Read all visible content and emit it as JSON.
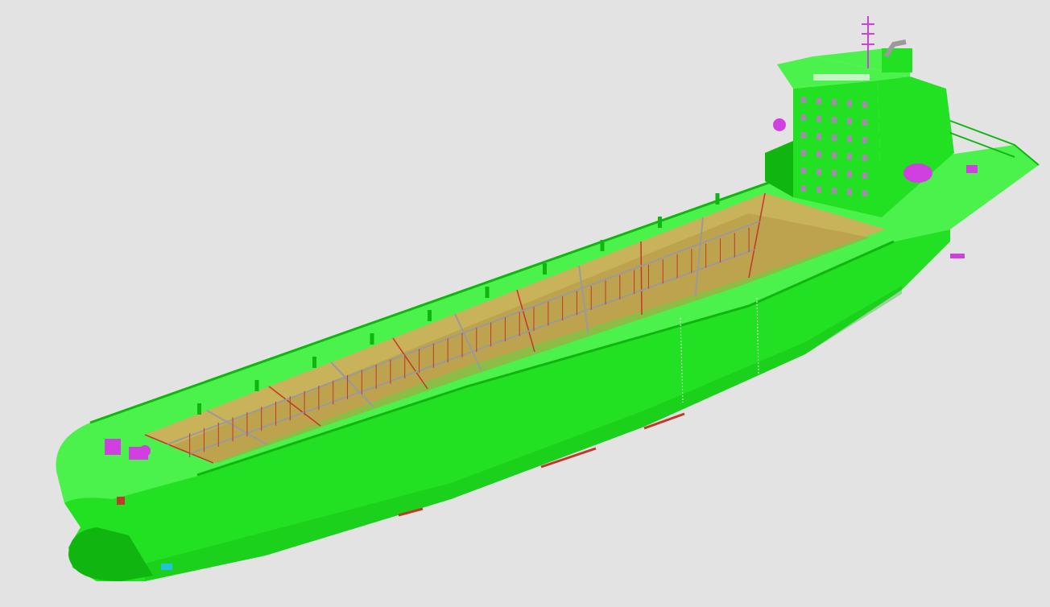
{
  "viewer": {
    "background": "#e3e3e3",
    "model": {
      "icon": "ship-3d-model-icon",
      "colors": {
        "hull": "#22e022",
        "hull_dark": "#10b510",
        "hull_light": "#4cf24c",
        "hold_interior": "#c8b25a",
        "hold_floor": "#b59a44",
        "frame_red": "#c0392b",
        "grid_gray": "#9a9a9a",
        "equipment_magenta": "#d040e0",
        "accent_cyan": "#22c3d8",
        "window": "#a88ab0"
      }
    }
  }
}
